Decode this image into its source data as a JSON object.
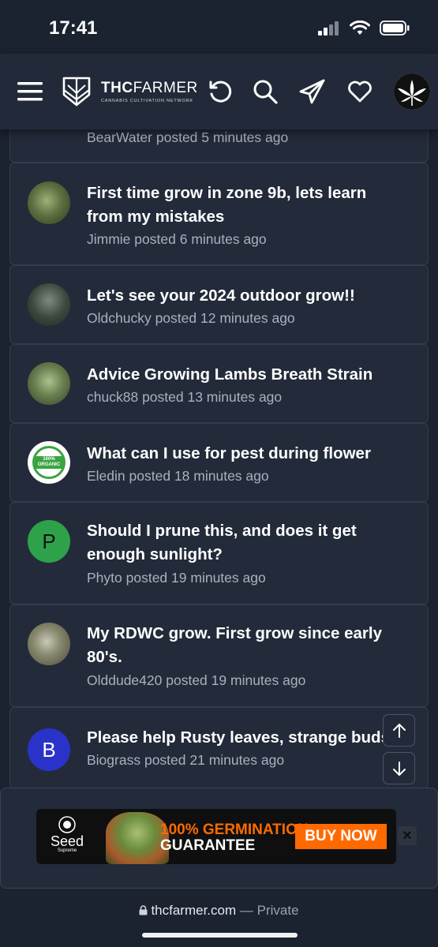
{
  "status": {
    "time": "17:41"
  },
  "brand": {
    "name_bold": "THC",
    "name_rest": "FARMER",
    "tagline": "CANNABIS CULTIVATION NETWORK"
  },
  "threads": [
    {
      "title": "",
      "author": "BearWater",
      "posted_ago": "5 minutes ago"
    },
    {
      "title": "First time grow in zone 9b, lets learn from my mistakes",
      "author": "Jimmie",
      "posted_ago": "6 minutes ago"
    },
    {
      "title": "Let's see your 2024 outdoor grow!!",
      "author": "Oldchucky",
      "posted_ago": "12 minutes ago"
    },
    {
      "title": "Advice Growing Lambs Breath Strain",
      "author": "chuck88",
      "posted_ago": "13 minutes ago"
    },
    {
      "title": "What can I use for pest during flower",
      "author": "Eledin",
      "posted_ago": "18 minutes ago",
      "avatar_text": "100% ORGANIC"
    },
    {
      "title": "Should I prune this, and does it get enough sunlight?",
      "author": "Phyto",
      "posted_ago": "19 minutes ago",
      "avatar_letter": "P"
    },
    {
      "title": "My RDWC grow. First grow since early 80's.",
      "author": "Olddude420",
      "posted_ago": "19 minutes ago"
    },
    {
      "title": "Please help Rusty leaves, strange buds",
      "author": "Biograss",
      "posted_ago": "21 minutes ago",
      "avatar_letter": "B"
    }
  ],
  "posted_word": "posted",
  "ad": {
    "brand": "Seed",
    "brand_sub": "Supreme",
    "headline_1": "100% GERMINATION",
    "headline_2": "GUARANTEE",
    "cta": "BUY NOW",
    "close": "×"
  },
  "browser": {
    "domain": "thcfarmer.com",
    "mode": "— Private"
  },
  "colors": {
    "background": "#1b2230",
    "card": "#232b3a",
    "meta": "#a9b1bf",
    "ad_orange": "#ff6a00",
    "phyto_avatar": "#2ea24a",
    "biograss_avatar": "#2a33c9"
  },
  "icons": [
    "menu-icon",
    "refresh-icon",
    "search-icon",
    "send-icon",
    "heart-icon",
    "arrow-up-icon",
    "arrow-down-icon",
    "lock-icon"
  ]
}
